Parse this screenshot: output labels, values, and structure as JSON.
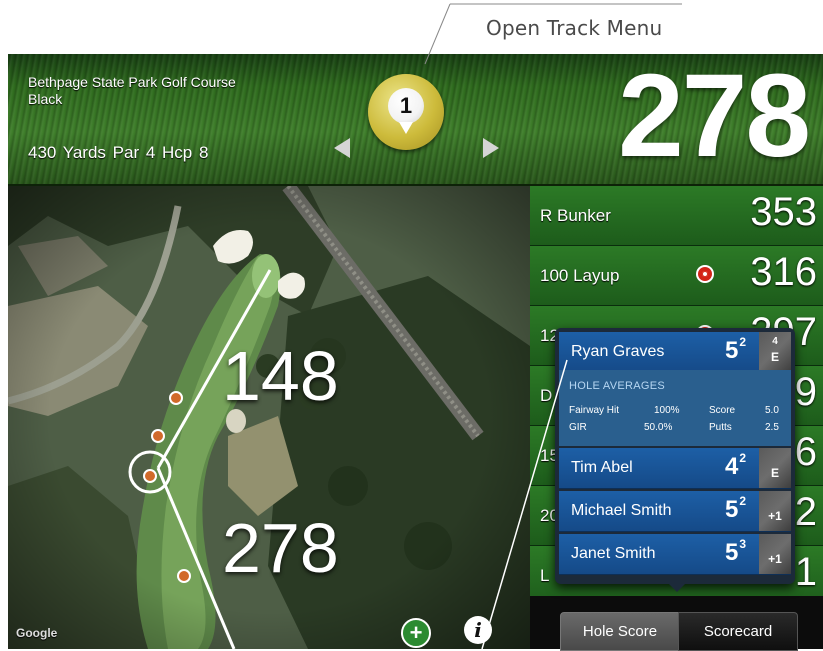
{
  "callout": {
    "label": "Open Track Menu"
  },
  "header": {
    "course_name": "Bethpage State Park Golf Course",
    "tee": "Black",
    "info": "430 Yards   Par 4   Hcp 8",
    "hole_number": "1",
    "distance": "278"
  },
  "map": {
    "distance_1": "148",
    "distance_2": "278",
    "attribution": "Google"
  },
  "targets": [
    {
      "label": "R Bunker",
      "value": "353",
      "has_target": false
    },
    {
      "label": "100 Layup",
      "value": "316",
      "has_target": true
    },
    {
      "label": "125 Layup",
      "value": "297",
      "has_target": true
    },
    {
      "label": "D",
      "value": "9",
      "has_target": false
    },
    {
      "label": "15",
      "value": "6",
      "has_target": false
    },
    {
      "label": "20",
      "value": "2",
      "has_target": false
    },
    {
      "label": "L",
      "value": "1",
      "has_target": false
    }
  ],
  "popup": {
    "players": [
      {
        "name": "Ryan Graves",
        "score": "5",
        "putts": "2",
        "to_par": "E",
        "hole_note": "4"
      },
      {
        "name": "Tim Abel",
        "score": "4",
        "putts": "2",
        "to_par": "E"
      },
      {
        "name": "Michael Smith",
        "score": "5",
        "putts": "2",
        "to_par": "+1"
      },
      {
        "name": "Janet Smith",
        "score": "5",
        "putts": "3",
        "to_par": "+1"
      }
    ],
    "averages": {
      "title": "HOLE AVERAGES",
      "fairway_label": "Fairway Hit",
      "fairway_value": "100%",
      "score_label": "Score",
      "score_value": "5.0",
      "gir_label": "GIR",
      "gir_value": "50.0%",
      "putts_label": "Putts",
      "putts_value": "2.5"
    }
  },
  "bottom": {
    "hole_score": "Hole Score",
    "scorecard": "Scorecard"
  },
  "colors": {
    "header_green": "#2e6b1d",
    "row_green": "#2c7a26",
    "popup_blue": "#1d5fa6",
    "target_red": "#d32418",
    "hole_gold": "#cdbb3b"
  },
  "icons": {
    "hole_marker": "golf-ball-tee-icon",
    "prev": "triangle-left-icon",
    "next": "triangle-right-icon",
    "add": "plus-circle-icon",
    "info": "info-icon",
    "target": "target-icon"
  }
}
